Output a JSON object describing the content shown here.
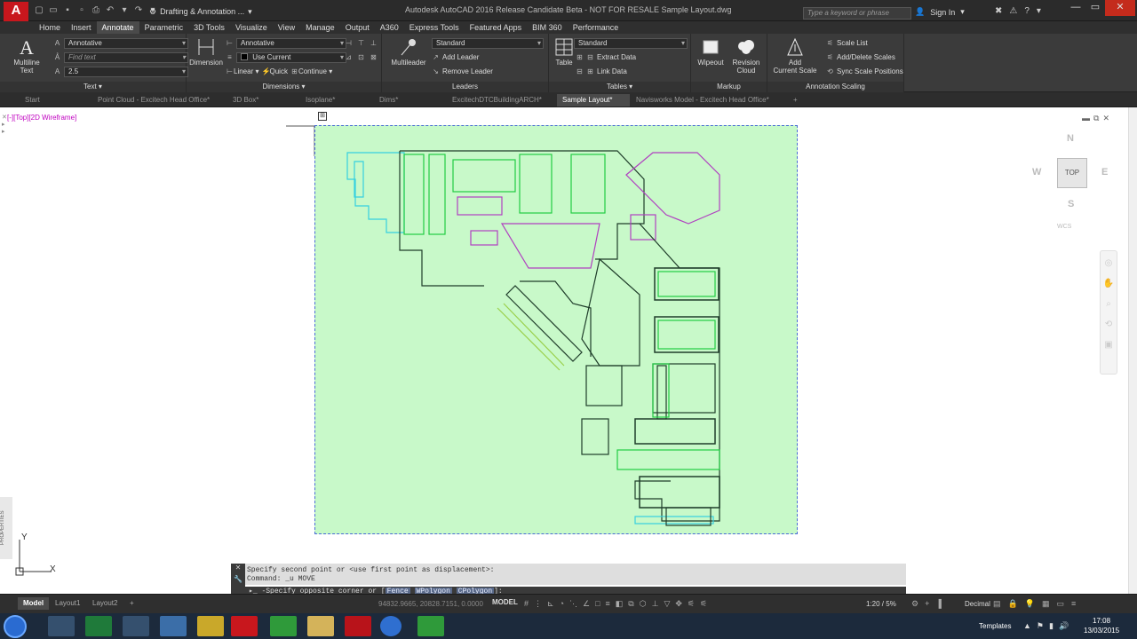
{
  "titlebar": {
    "app_logo": "A",
    "workspace": "Drafting & Annotation ...",
    "title": "Autodesk AutoCAD 2016 Release Candidate Beta - NOT FOR RESALE    Sample Layout.dwg",
    "search_placeholder": "Type a keyword or phrase",
    "signin": "Sign In"
  },
  "ribbon_tabs": [
    "Home",
    "Insert",
    "Annotate",
    "Parametric",
    "3D Tools",
    "Visualize",
    "View",
    "Manage",
    "Output",
    "A360",
    "Express Tools",
    "Featured Apps",
    "BIM 360",
    "Performance"
  ],
  "ribbon": {
    "text_panel": {
      "title": "Text",
      "multiline_text": "Multiline\nText",
      "style": "Annotative",
      "find_placeholder": "Find text",
      "height": "2.5"
    },
    "dimensions_panel": {
      "title": "Dimensions",
      "dimension": "Dimension",
      "style": "Annotative",
      "layer": "Use Current",
      "linear": "Linear",
      "quick": "Quick",
      "continue": "Continue"
    },
    "leaders_panel": {
      "title": "Leaders",
      "multileader": "Multileader",
      "style": "Standard",
      "add_leader": "Add Leader",
      "remove_leader": "Remove Leader"
    },
    "tables_panel": {
      "title": "Tables",
      "table": "Table",
      "style": "Standard",
      "extract_data": "Extract Data",
      "link_data": "Link Data"
    },
    "markup_panel": {
      "title": "Markup",
      "wipeout": "Wipeout",
      "revision_cloud": "Revision\nCloud"
    },
    "annotation_scaling_panel": {
      "title": "Annotation Scaling",
      "add_current_scale": "Add\nCurrent Scale",
      "scale_list": "Scale List",
      "add_delete_scales": "Add/Delete Scales",
      "sync_scale_positions": "Sync Scale Positions"
    }
  },
  "file_tabs": [
    "Start",
    "Point Cloud - Excitech Head Office*",
    "3D Box*",
    "Isoplane*",
    "Dims*",
    "ExcitechDTCBuildingARCH*",
    "Sample Layout*",
    "Navisworks Model - Excitech Head Office*"
  ],
  "viewport_label": "[-][Top][2D Wireframe]",
  "viewcube": {
    "n": "N",
    "s": "S",
    "e": "E",
    "w": "W",
    "top": "TOP",
    "wcs": "WCS"
  },
  "ucs": {
    "y": "Y",
    "x": "X"
  },
  "side_panel_label": "PROPERTIES",
  "command": {
    "history": [
      "Specify second point or <use first point as displacement>:",
      "Command: _u MOVE"
    ],
    "prompt_prefix": "-Specify opposite corner or [",
    "options": [
      "Fence",
      "WPolygon",
      "CPolygon"
    ],
    "prompt_suffix": "]:"
  },
  "status": {
    "layout_tabs": [
      "Model",
      "Layout1",
      "Layout2"
    ],
    "coords": "94832.9665, 20828.7151, 0.0000",
    "model": "MODEL",
    "scale": "1:20 / 5%",
    "units": "Decimal"
  },
  "taskbar": {
    "templates": "Templates",
    "time": "17:08",
    "date": "13/03/2015"
  },
  "colors": {
    "sheet_fill": "#c8f9c9",
    "floorplan_dark": "#1f3d2a",
    "floorplan_green": "#22cc44",
    "floorplan_cyan": "#35d0e0",
    "floorplan_magenta": "#b040c0",
    "viewport_label": "#c000c0"
  }
}
